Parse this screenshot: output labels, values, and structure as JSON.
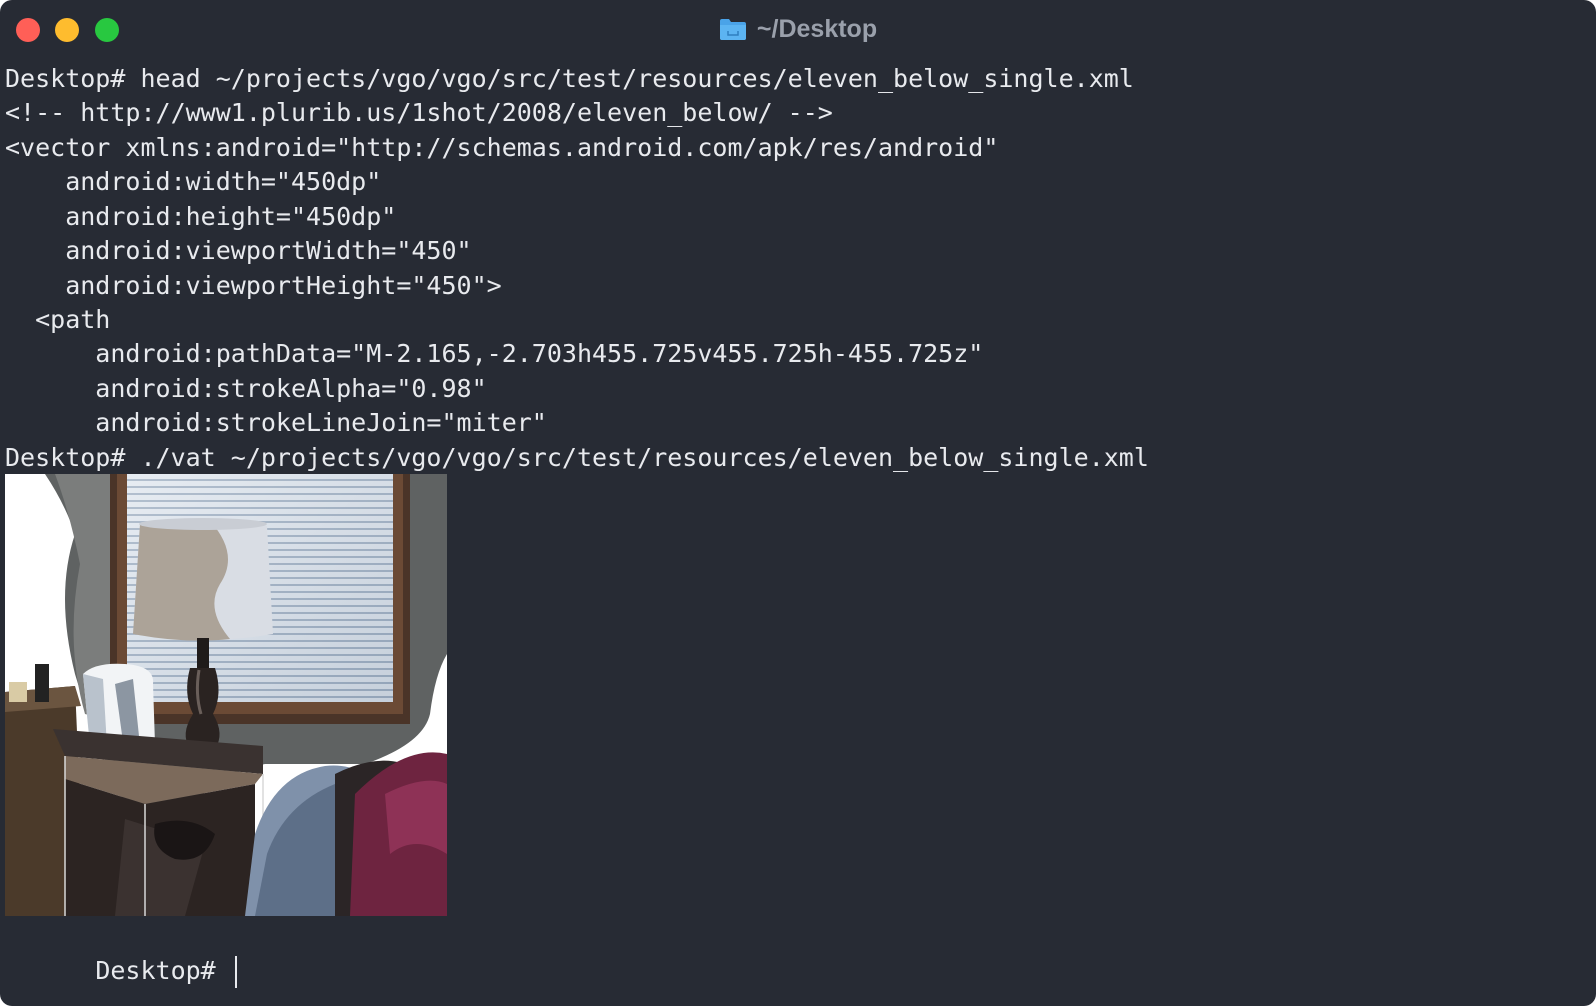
{
  "window": {
    "title": "~/Desktop"
  },
  "icons": {
    "title_icon": "folder-icon",
    "close": "close-button-icon",
    "minimize": "minimize-button-icon",
    "maximize": "maximize-button-icon"
  },
  "colors": {
    "background": "#272b34",
    "text": "#e8eaee",
    "title": "#9aa0ab",
    "close": "#ff5f57",
    "minimize": "#febc2e",
    "maximize": "#28c840",
    "folder": "#4aa3e8"
  },
  "terminal": {
    "lines": [
      "Desktop# head ~/projects/vgo/vgo/src/test/resources/eleven_below_single.xml",
      "<!-- http://www1.plurib.us/1shot/2008/eleven_below/ -->",
      "<vector xmlns:android=\"http://schemas.android.com/apk/res/android\"",
      "    android:width=\"450dp\"",
      "    android:height=\"450dp\"",
      "    android:viewportWidth=\"450\"",
      "    android:viewportHeight=\"450\">",
      "  <path",
      "      android:pathData=\"M-2.165,-2.703h455.725v455.725h-455.725z\"",
      "      android:strokeAlpha=\"0.98\"",
      "      android:strokeLineJoin=\"miter\"",
      "Desktop# ./vat ~/projects/vgo/vgo/src/test/resources/eleven_below_single.xml"
    ],
    "prompt": "Desktop# "
  },
  "rendered_image": {
    "description_icon": "vector-illustration-room-lamp"
  }
}
